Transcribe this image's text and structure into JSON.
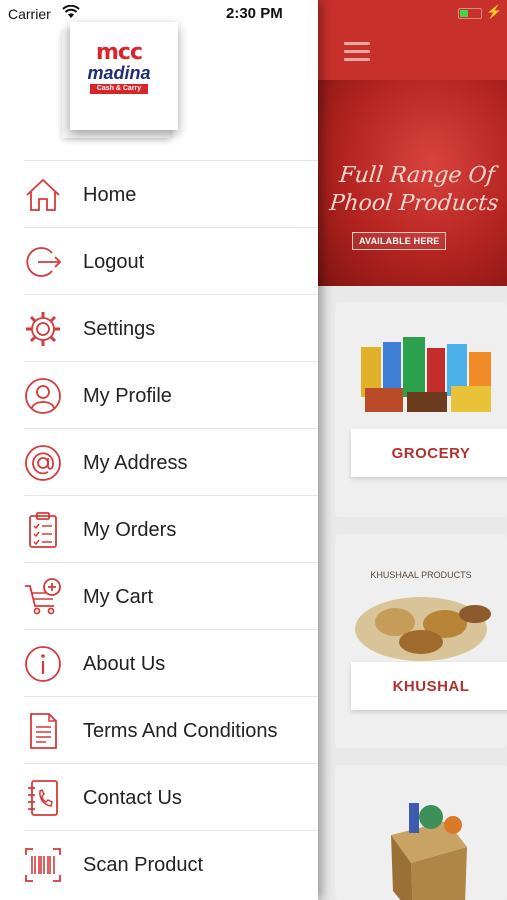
{
  "status_bar": {
    "carrier": "Carrier",
    "time": "2:30 PM"
  },
  "brand": {
    "logo_mark": "mcc",
    "logo_name": "madina",
    "logo_tag": "Cash & Carry"
  },
  "menu": {
    "items": [
      {
        "label": "Home",
        "icon": "home-icon"
      },
      {
        "label": "Logout",
        "icon": "logout-icon"
      },
      {
        "label": "Settings",
        "icon": "gear-icon"
      },
      {
        "label": "My Profile",
        "icon": "user-icon"
      },
      {
        "label": "My Address",
        "icon": "at-icon"
      },
      {
        "label": "My Orders",
        "icon": "clipboard-icon"
      },
      {
        "label": "My Cart",
        "icon": "cart-add-icon"
      },
      {
        "label": "About Us",
        "icon": "info-icon"
      },
      {
        "label": "Terms And Conditions",
        "icon": "document-icon"
      },
      {
        "label": "Contact Us",
        "icon": "phone-book-icon"
      },
      {
        "label": "Scan Product",
        "icon": "barcode-icon"
      }
    ]
  },
  "background": {
    "banner": {
      "title": "Full Range Of Phool Products",
      "button": "AVAILABLE HERE"
    },
    "categories": [
      {
        "label": "GROCERY",
        "caption": ""
      },
      {
        "label": "KHUSHAL",
        "caption": "KHUSHAAL PRODUCTS"
      },
      {
        "label": "",
        "caption": ""
      }
    ]
  },
  "colors": {
    "accent": "#d9262b",
    "header": "#c8302c",
    "icon": "#d63a3a"
  }
}
